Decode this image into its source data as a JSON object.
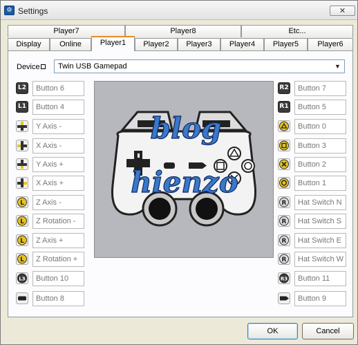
{
  "window": {
    "title": "Settings",
    "close_glyph": "✕",
    "app_icon": "gear-icon"
  },
  "tabs_top": [
    {
      "label": "Player7"
    },
    {
      "label": "Player8"
    },
    {
      "label": "Etc..."
    }
  ],
  "tabs_bottom": [
    {
      "label": "Display"
    },
    {
      "label": "Online"
    },
    {
      "label": "Player1",
      "active": true
    },
    {
      "label": "Player2"
    },
    {
      "label": "Player3"
    },
    {
      "label": "Player4"
    },
    {
      "label": "Player5"
    },
    {
      "label": "Player6"
    }
  ],
  "device": {
    "label": "Device",
    "value": "Twin USB Gamepad"
  },
  "left_bindings": [
    {
      "control": "L2",
      "icon": "l2-icon",
      "value": "Button 6"
    },
    {
      "control": "L1",
      "icon": "l1-icon",
      "value": "Button 4"
    },
    {
      "control": "dpad-up",
      "icon": "dpad-up-icon",
      "value": "Y Axis -"
    },
    {
      "control": "dpad-left",
      "icon": "dpad-left-icon",
      "value": "X Axis -"
    },
    {
      "control": "dpad-down",
      "icon": "dpad-down-icon",
      "value": "Y Axis +"
    },
    {
      "control": "dpad-right",
      "icon": "dpad-right-icon",
      "value": "X Axis +"
    },
    {
      "control": "L-up",
      "icon": "left-stick-up-icon",
      "value": "Z Axis -"
    },
    {
      "control": "L-left",
      "icon": "left-stick-left-icon",
      "value": "Z Rotation -"
    },
    {
      "control": "L-down",
      "icon": "left-stick-down-icon",
      "value": "Z Axis +"
    },
    {
      "control": "L-right",
      "icon": "left-stick-right-icon",
      "value": "Z Rotation +"
    },
    {
      "control": "L3",
      "icon": "l3-icon",
      "value": "Button 10"
    },
    {
      "control": "select",
      "icon": "select-icon",
      "value": "Button 8"
    }
  ],
  "right_bindings": [
    {
      "control": "R2",
      "icon": "r2-icon",
      "value": "Button 7"
    },
    {
      "control": "R1",
      "icon": "r1-icon",
      "value": "Button 5"
    },
    {
      "control": "triangle",
      "icon": "triangle-icon",
      "value": "Button 0"
    },
    {
      "control": "square",
      "icon": "square-icon",
      "value": "Button 3"
    },
    {
      "control": "cross",
      "icon": "cross-icon",
      "value": "Button 2"
    },
    {
      "control": "circle",
      "icon": "circle-icon",
      "value": "Button 1"
    },
    {
      "control": "R-up",
      "icon": "right-stick-up-icon",
      "value": "Hat Switch N"
    },
    {
      "control": "R-down",
      "icon": "right-stick-down-icon",
      "value": "Hat Switch S"
    },
    {
      "control": "R-right",
      "icon": "right-stick-right-icon",
      "value": "Hat Switch E"
    },
    {
      "control": "R-left",
      "icon": "right-stick-left-icon",
      "value": "Hat Switch W"
    },
    {
      "control": "R3",
      "icon": "r3-icon",
      "value": "Button 11"
    },
    {
      "control": "start",
      "icon": "start-icon",
      "value": "Button 9"
    }
  ],
  "watermark": {
    "line1": "blog",
    "line2": "hienzo"
  },
  "buttons": {
    "ok": "OK",
    "cancel": "Cancel"
  }
}
